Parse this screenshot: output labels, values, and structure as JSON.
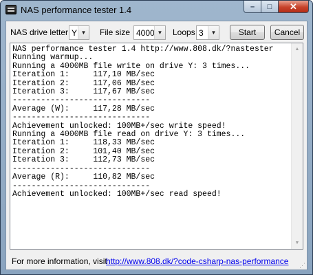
{
  "window": {
    "title": "NAS performance tester 1.4",
    "controls": {
      "minimize": "–",
      "maximize": "□",
      "close": "✕"
    }
  },
  "toolbar": {
    "drive_label": "NAS drive letter",
    "drive_value": "Y",
    "filesize_label": "File size",
    "filesize_value": "4000",
    "loops_label": "Loops",
    "loops_value": "3",
    "start_label": "Start",
    "cancel_label": "Cancel"
  },
  "log": {
    "lines": [
      "NAS performance tester 1.4 http://www.808.dk/?nastester",
      "Running warmup...",
      "Running a 4000MB file write on drive Y: 3 times...",
      "Iteration 1:     117,10 MB/sec",
      "Iteration 2:     117,06 MB/sec",
      "Iteration 3:     117,67 MB/sec",
      "-----------------------------",
      "Average (W):     117,28 MB/sec",
      "-----------------------------",
      "Achievement unlocked: 100MB+/sec write speed!",
      "Running a 4000MB file read on drive Y: 3 times...",
      "Iteration 1:     118,33 MB/sec",
      "Iteration 2:     101,40 MB/sec",
      "Iteration 3:     112,73 MB/sec",
      "-----------------------------",
      "Average (R):     110,82 MB/sec",
      "-----------------------------",
      "Achievement unlocked: 100MB+/sec read speed!"
    ]
  },
  "footer": {
    "info_text": "For more information, visit",
    "link_text": "http://www.808.dk/?code-csharp-nas-performance"
  },
  "icons": {
    "app": "app-icon",
    "dropdown": "chevron-down-icon",
    "scroll_up": "scroll-up-arrow-icon",
    "scroll_down": "scroll-down-arrow-icon",
    "resize": "resize-grip-icon"
  },
  "colors": {
    "titlebar": "#9fb6cd",
    "client": "#f0f0f0",
    "link": "#0000ee",
    "close_button": "#c7432b"
  }
}
